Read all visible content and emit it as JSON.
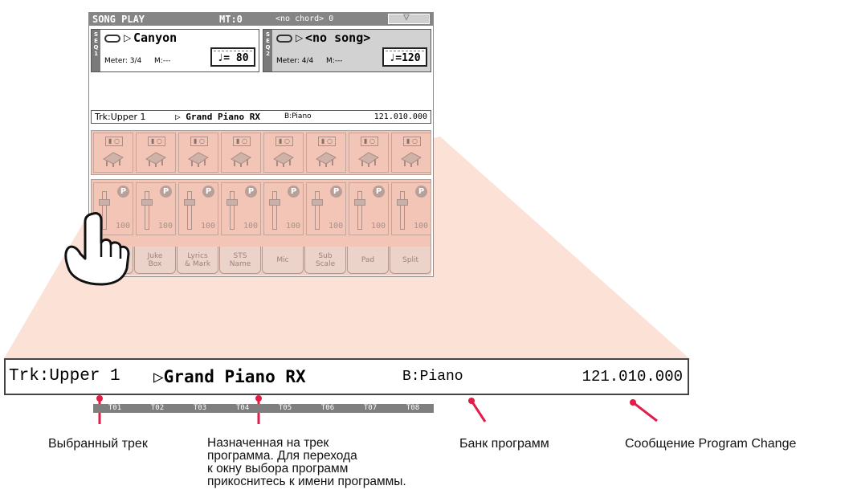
{
  "topbar": {
    "mode": "SONG PLAY",
    "mt": "MT:0",
    "chord": "<no chord> 0"
  },
  "seq1": {
    "tab": "SEQ1",
    "name": "Canyon",
    "meter": "Meter: 3/4",
    "measure": "M:---",
    "tempo": "♩= 80"
  },
  "seq2": {
    "tab": "SEQ2",
    "name": "<no song>",
    "meter": "Meter: 4/4",
    "measure": "M:---",
    "tempo": "♩=120"
  },
  "track_info": {
    "track": "Trk:Upper 1",
    "program": "Grand Piano RX",
    "bank": "B:Piano",
    "pc": "121.010.000"
  },
  "zoom": {
    "track": "Trk:Upper 1",
    "program": "Grand Piano RX",
    "bank": "B:Piano",
    "pc": "121.010.000"
  },
  "tracks": [
    {
      "label": "T01",
      "volume": "100"
    },
    {
      "label": "T02",
      "volume": "100"
    },
    {
      "label": "T03",
      "volume": "100"
    },
    {
      "label": "T04",
      "volume": "100"
    },
    {
      "label": "T05",
      "volume": "100"
    },
    {
      "label": "T06",
      "volume": "100"
    },
    {
      "label": "T07",
      "volume": "100"
    },
    {
      "label": "T08",
      "volume": "100"
    }
  ],
  "tabs": [
    "Volume",
    "Juke\nBox",
    "Lyrics\n& Mark",
    "STS\nName",
    "Mic",
    "Sub\nScale",
    "Pad",
    "Split"
  ],
  "captions": {
    "track": "Выбранный трек",
    "program": "Назначенная на трек\nпрограмма. Для перехода\nк окну выбора программ\nприкоснитесь к имени программы.",
    "bank": "Банк программ",
    "pc": "Сообщение Program Change"
  },
  "colors": {
    "zoom_fill": "#fbe1d6",
    "pointer": "#e11d48",
    "panel": "#f2c5b6"
  }
}
